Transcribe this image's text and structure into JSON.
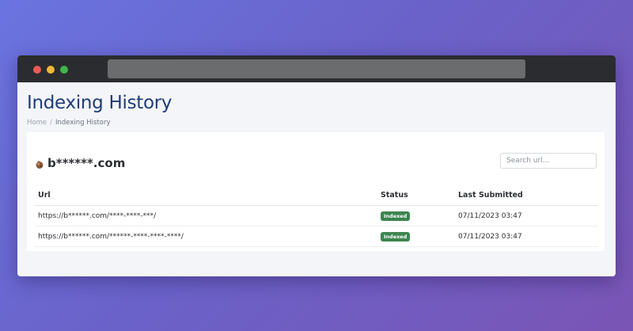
{
  "page": {
    "title": "Indexing History",
    "breadcrumb": {
      "home": "Home",
      "separator": "/",
      "current": "Indexing History"
    }
  },
  "site": {
    "name": "b******.com"
  },
  "search": {
    "placeholder": "Search url..."
  },
  "table": {
    "columns": {
      "url": "Url",
      "status": "Status",
      "last_submitted": "Last Submitted"
    },
    "rows": [
      {
        "url": "https://b******.com/****-****-***/",
        "status": "Indexed",
        "last_submitted": "07/11/2023 03:47"
      },
      {
        "url": "https://b******.com/******-****-****-****/",
        "status": "Indexed",
        "last_submitted": "07/11/2023 03:47"
      }
    ]
  },
  "colors": {
    "title": "#1f3c7a",
    "badge": "#3d8550",
    "titlebar": "#2b2c2f"
  }
}
